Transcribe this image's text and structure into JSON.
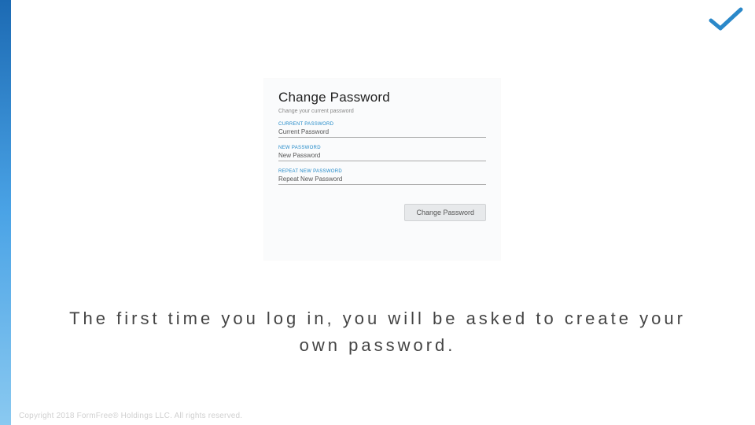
{
  "panel": {
    "title": "Change Password",
    "subtitle": "Change your current password"
  },
  "fields": {
    "current": {
      "label": "CURRENT PASSWORD",
      "value": "Current Password"
    },
    "new": {
      "label": "NEW PASSWORD",
      "value": "New Password"
    },
    "repeat": {
      "label": "REPEAT NEW PASSWORD",
      "value": "Repeat New Password"
    }
  },
  "button": {
    "label": "Change Password"
  },
  "caption": "The first time you log in, you will be asked to create your own password.",
  "footer": "Copyright 2018 FormFree® Holdings LLC. All rights reserved."
}
